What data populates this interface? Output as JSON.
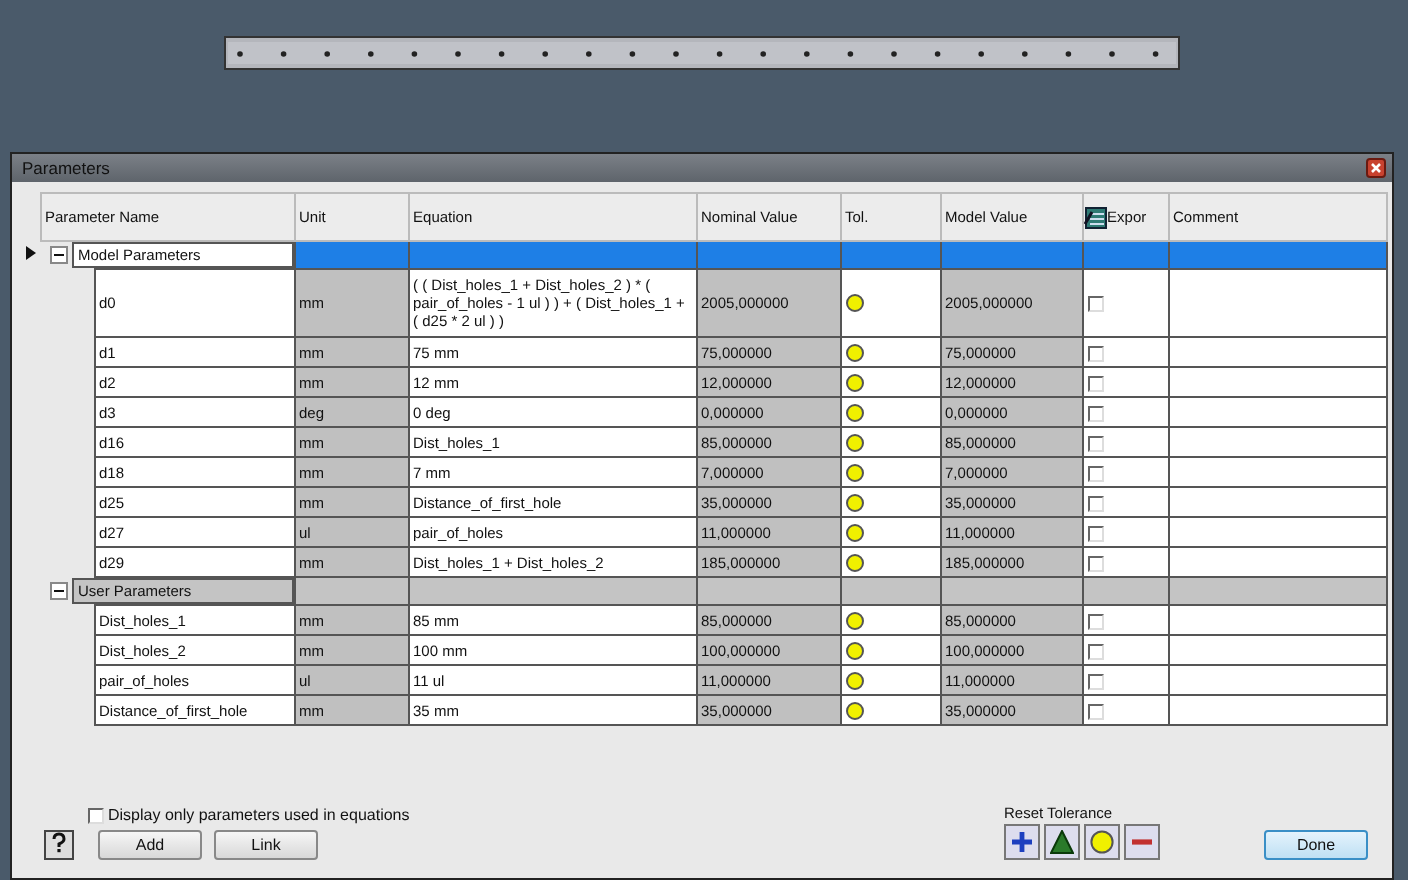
{
  "window": {
    "title": "Parameters"
  },
  "table": {
    "columns": [
      "Parameter Name",
      "Unit",
      "Equation",
      "Nominal Value",
      "Tol.",
      "Model Value",
      "Expor",
      "Comment"
    ],
    "groups": [
      {
        "label": "Model Parameters",
        "expanded": true,
        "selected": true,
        "rows": [
          {
            "name": "d0",
            "unit": "mm",
            "equation": "( ( Dist_holes_1 + Dist_holes_2 ) * ( pair_of_holes - 1 ul ) ) + ( Dist_holes_1 + ( d25 * 2 ul ) )",
            "nominal": "2005,000000",
            "color": "#f0f000",
            "model": "2005,000000",
            "export": false
          },
          {
            "name": "d1",
            "unit": "mm",
            "equation": "75 mm",
            "nominal": "75,000000",
            "color": "#f0f000",
            "model": "75,000000",
            "export": false
          },
          {
            "name": "d2",
            "unit": "mm",
            "equation": "12 mm",
            "nominal": "12,000000",
            "color": "#f0f000",
            "model": "12,000000",
            "export": false
          },
          {
            "name": "d3",
            "unit": "deg",
            "equation": "0 deg",
            "nominal": "0,000000",
            "color": "#f0f000",
            "model": "0,000000",
            "export": false
          },
          {
            "name": "d16",
            "unit": "mm",
            "equation": "Dist_holes_1",
            "nominal": "85,000000",
            "color": "#f0f000",
            "model": "85,000000",
            "export": false
          },
          {
            "name": "d18",
            "unit": "mm",
            "equation": "7 mm",
            "nominal": "7,000000",
            "color": "#f0f000",
            "model": "7,000000",
            "export": false
          },
          {
            "name": "d25",
            "unit": "mm",
            "equation": "Distance_of_first_hole",
            "nominal": "35,000000",
            "color": "#f0f000",
            "model": "35,000000",
            "export": false
          },
          {
            "name": "d27",
            "unit": "ul",
            "equation": "pair_of_holes",
            "nominal": "11,000000",
            "color": "#f0f000",
            "model": "11,000000",
            "export": false
          },
          {
            "name": "d29",
            "unit": "mm",
            "equation": "Dist_holes_1 + Dist_holes_2",
            "nominal": "185,000000",
            "color": "#f0f000",
            "model": "185,000000",
            "export": false
          }
        ]
      },
      {
        "label": "User Parameters",
        "expanded": true,
        "selected": false,
        "rows": [
          {
            "name": "Dist_holes_1",
            "unit": "mm",
            "equation": "85 mm",
            "nominal": "85,000000",
            "color": "#f0f000",
            "model": "85,000000",
            "export": false
          },
          {
            "name": "Dist_holes_2",
            "unit": "mm",
            "equation": "100 mm",
            "nominal": "100,000000",
            "color": "#f0f000",
            "model": "100,000000",
            "export": false
          },
          {
            "name": "pair_of_holes",
            "unit": "ul",
            "equation": "11 ul",
            "nominal": "11,000000",
            "color": "#f0f000",
            "model": "11,000000",
            "export": false
          },
          {
            "name": "Distance_of_first_hole",
            "unit": "mm",
            "equation": "35 mm",
            "nominal": "35,000000",
            "color": "#f0f000",
            "model": "35,000000",
            "export": false
          }
        ]
      }
    ]
  },
  "filter": {
    "label": "Display only parameters used in equations",
    "checked": false
  },
  "buttons": [
    "Add",
    "Link"
  ],
  "reset_tolerance": {
    "label": "Reset Tolerance"
  },
  "done_button": "Done"
}
